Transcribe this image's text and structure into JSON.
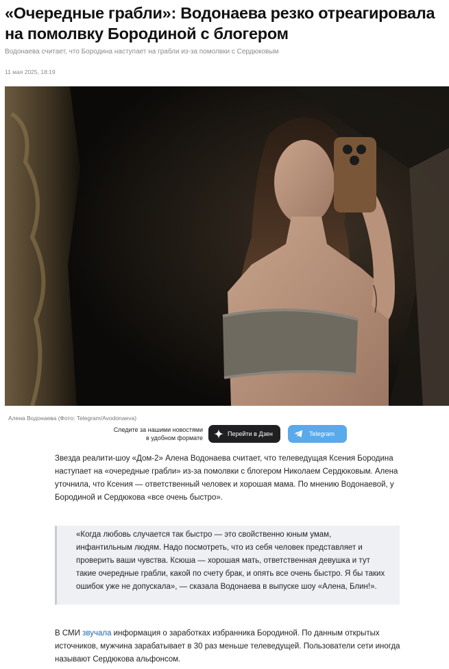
{
  "article": {
    "title": "«Очередные грабли»: Водонаева резко отреагировала на помолвку Бородиной с блогером",
    "subtitle": "Водонаева считает, что Бородина наступает на грабли из-за помолвки с Сердюковым",
    "date": "11 мая 2025, 18:19",
    "photo_caption": "Алена Водонаева (Фото: Telegram/Avodonaeva)",
    "paragraph_1": "Звезда реалити-шоу «Дом-2» Алена Водонаева считает, что телеведущая Ксения Бородина наступает на «очередные грабли» из-за помолвки с блогером Николаем Сердюковым. Алена уточнила, что Ксения — ответственный человек и хорошая мама. По мнению Водонаевой, у Бородиной и Сердюкова «все очень быстро».",
    "quote": "«Когда любовь случается так быстро — это свойственно юным умам, инфантильным людям. Надо посмотреть, что из себя человек представляет и проверить ваши чувства. Ксюша — хорошая мать, ответственная девушка и тут такие очередные грабли, какой по счету брак, и опять все очень быстро. Я бы таких ошибок уже не допускала», — сказала Водонаева в выпуске шоу «Алена, Блин!».",
    "paragraph_2_before": "В СМИ ",
    "paragraph_2_link": "звучала",
    "paragraph_2_after": " информация о заработках избранника Бородиной. По данным открытых источников, мужчина зарабатывает в 30 раз меньше телеведущей. Пользователи сети иногда называют Сердюкова альфонсом."
  },
  "follow": {
    "text": "Следите за нашими новостями\nв удобном формате",
    "dzen_label": "Перейти в Дзен",
    "dzen_icon": "dzen-star-icon",
    "telegram_label": "Telegram",
    "telegram_icon": "telegram-plane-icon"
  },
  "colors": {
    "dzen_button": "#202022",
    "telegram_button": "#5aa9ea",
    "link": "#1a66b5",
    "quote_bg": "#eef0f4"
  }
}
